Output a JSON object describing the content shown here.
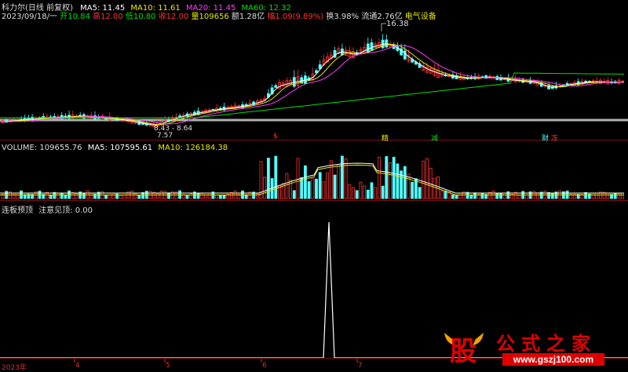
{
  "header": {
    "stock_name": "科力尔(日线 前复权)",
    "ma5": "MA5: 11.45",
    "ma10": "MA10: 11.61",
    "ma20": "MA20: 11.45",
    "ma60": "MA60: 12.32",
    "date": "2023/09/18/一",
    "open": "开10.84",
    "high": "高12.00",
    "low": "低10.80",
    "close": "收12.00",
    "volume": "量109656",
    "amount": "额1.28亿",
    "change": "幅1.09(9.89%)",
    "turnover": "换3.98%",
    "float": "流通2.76亿",
    "industry": "电气设备"
  },
  "colors": {
    "ma5": "#ffffff",
    "ma10": "#e8e800",
    "ma20": "#ff3cff",
    "ma60": "#00e000",
    "up": "#ff3232",
    "down": "#54ffff",
    "separator": "#7a1010"
  },
  "price_chart": {
    "high_label": "16.38",
    "low_label": "7.57",
    "range_label": "8.43 - 8.64",
    "events": [
      {
        "text": "$",
        "color": "#ff3232"
      },
      {
        "text": "精",
        "color": "#e8e800"
      },
      {
        "text": "减",
        "color": "#00e000"
      },
      {
        "text": "财",
        "color": "#54ffff"
      },
      {
        "text": "冻",
        "color": "#ff3232"
      }
    ]
  },
  "volume_panel": {
    "label": "VOLUME: 109655.76",
    "ma5": "MA5: 107595.61",
    "ma10": "MA10: 126184.38"
  },
  "indicator_panel": {
    "label": "连板预顶",
    "value": "注意见顶: 0.00"
  },
  "x_axis": {
    "labels": [
      "2023年",
      "4",
      "5",
      "6",
      "7"
    ]
  },
  "watermark": {
    "logo_char": "股",
    "brand": "公式之家",
    "url": "www.gszj100.com"
  }
}
